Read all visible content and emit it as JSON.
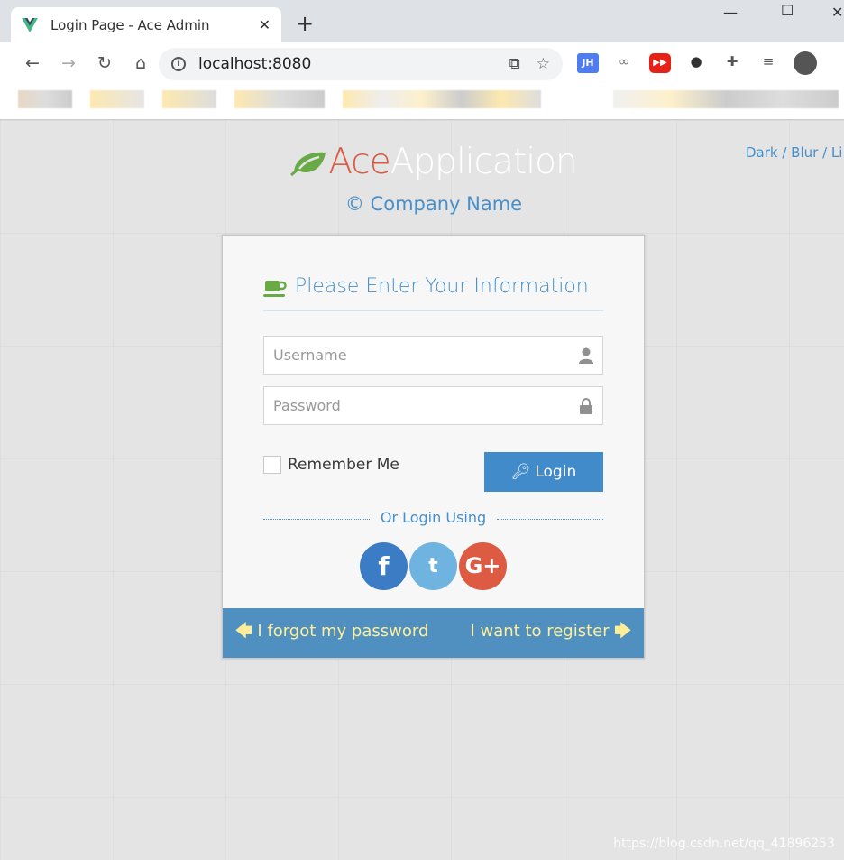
{
  "browser": {
    "tab_title": "Login Page - Ace Admin",
    "url": "localhost:8080",
    "icons": [
      "vue-favicon",
      "close-icon",
      "new-tab-icon",
      "minimize-icon",
      "maximize-icon",
      "close-window-icon",
      "back-icon",
      "forward-icon",
      "reload-icon",
      "home-icon",
      "info-icon",
      "translate-icon",
      "star-icon",
      "jh-extension-icon",
      "extension-icon",
      "youtube-extension-icon",
      "evernote-icon",
      "puzzle-icon",
      "media-icon",
      "profile-icon"
    ],
    "extension_jh": "JH"
  },
  "page": {
    "theme_switch": "Dark / Blur / Li",
    "brand_ace": "Ace",
    "brand_app": "Application",
    "company": "© Company Name",
    "form": {
      "header": "Please Enter Your Information",
      "username_placeholder": "Username",
      "password_placeholder": "Password",
      "remember": "Remember Me",
      "login": "Login",
      "or_login_using": "Or Login Using",
      "social": [
        "f",
        "t",
        "G+"
      ]
    },
    "footer": {
      "forgot": "I forgot my password",
      "register": "I want to register"
    },
    "watermark": "https://blog.csdn.net/qq_41896253"
  },
  "colors": {
    "brand_ace": "#dd5a43",
    "accent": "#478fca",
    "button": "#428bca",
    "footer": "#5090c1",
    "footer_text": "#ffee99",
    "facebook": "#3b7cc4",
    "twitter": "#6fb3e0",
    "google": "#dd5a43",
    "leaf": "#69aa46"
  }
}
